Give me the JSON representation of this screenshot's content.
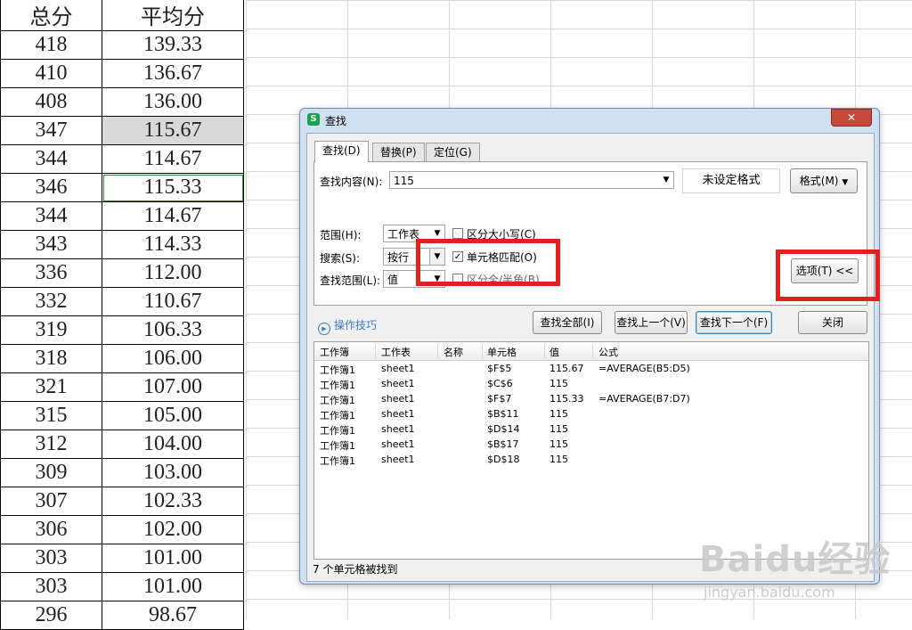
{
  "sheet": {
    "headers": [
      "总分",
      "平均分"
    ],
    "rows": [
      [
        "418",
        "139.33"
      ],
      [
        "410",
        "136.67"
      ],
      [
        "408",
        "136.00"
      ],
      [
        "347",
        "115.67"
      ],
      [
        "344",
        "114.67"
      ],
      [
        "346",
        "115.33"
      ],
      [
        "344",
        "114.67"
      ],
      [
        "343",
        "114.33"
      ],
      [
        "336",
        "112.00"
      ],
      [
        "332",
        "110.67"
      ],
      [
        "319",
        "106.33"
      ],
      [
        "318",
        "106.00"
      ],
      [
        "321",
        "107.00"
      ],
      [
        "315",
        "105.00"
      ],
      [
        "312",
        "104.00"
      ],
      [
        "309",
        "103.00"
      ],
      [
        "307",
        "102.33"
      ],
      [
        "306",
        "102.00"
      ],
      [
        "303",
        "101.00"
      ],
      [
        "303",
        "101.00"
      ],
      [
        "296",
        "98.67"
      ]
    ]
  },
  "dialog": {
    "title": "查找",
    "app_icon": "S",
    "close_glyph": "✕",
    "tabs": [
      "查找(D)",
      "替换(P)",
      "定位(G)"
    ],
    "find_label": "查找内容(N):",
    "find_value": "115",
    "format_status": "未设定格式",
    "format_button": "格式(M)",
    "scope_label": "范围(H):",
    "scope_value": "工作表",
    "search_label": "搜索(S):",
    "search_value": "按行",
    "lookin_label": "查找范围(L):",
    "lookin_value": "值",
    "match_case": "区分大小写(C)",
    "match_cell": "单元格匹配(O)",
    "match_width": "区分全/半角(B)",
    "options_button": "选项(T) <<",
    "tips": "操作技巧",
    "find_all": "查找全部(I)",
    "find_prev": "查找上一个(V)",
    "find_next": "查找下一个(F)",
    "close_button": "关闭",
    "results_headers": [
      "工作簿",
      "工作表",
      "名称",
      "单元格",
      "值",
      "公式"
    ],
    "results": [
      [
        "工作簿1",
        "sheet1",
        "",
        "$F$5",
        "115.67",
        "=AVERAGE(B5:D5)"
      ],
      [
        "工作簿1",
        "sheet1",
        "",
        "$C$6",
        "115",
        ""
      ],
      [
        "工作簿1",
        "sheet1",
        "",
        "$F$7",
        "115.33",
        "=AVERAGE(B7:D7)"
      ],
      [
        "工作簿1",
        "sheet1",
        "",
        "$B$11",
        "115",
        ""
      ],
      [
        "工作簿1",
        "sheet1",
        "",
        "$D$14",
        "115",
        ""
      ],
      [
        "工作簿1",
        "sheet1",
        "",
        "$B$17",
        "115",
        ""
      ],
      [
        "工作簿1",
        "sheet1",
        "",
        "$D$18",
        "115",
        ""
      ]
    ],
    "status": "7 个单元格被找到"
  },
  "watermark": {
    "logo": "Baidu经验",
    "url": "jingyan.baidu.com"
  },
  "colors": {
    "highlight": "#e32020",
    "dialog_frame": "#cfe0f3",
    "tips_link": "#3d7cc9"
  }
}
